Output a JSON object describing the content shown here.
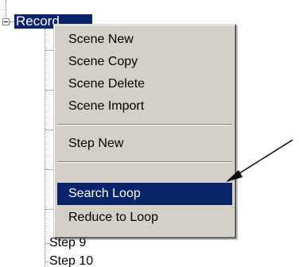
{
  "tree": {
    "root_label": "Record",
    "visible_items": [
      "Step 9",
      "Step 10"
    ]
  },
  "context_menu": {
    "items": [
      {
        "label": "Scene New"
      },
      {
        "label": "Scene Copy"
      },
      {
        "label": "Scene Delete"
      },
      {
        "label": "Scene Import"
      },
      {
        "label": "Step New"
      },
      {
        "label": "Search Loop",
        "highlighted": true
      },
      {
        "label": "Reduce to Loop"
      }
    ]
  },
  "colors": {
    "selection": "#0a246a",
    "menu_face": "#d4d0c8"
  }
}
